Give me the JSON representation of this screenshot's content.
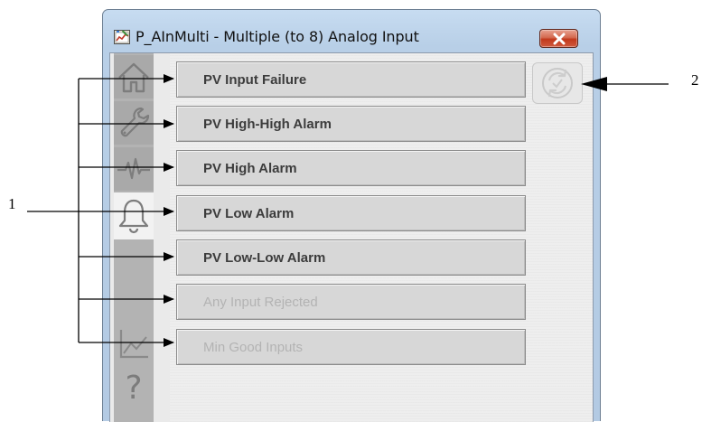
{
  "window": {
    "title": "P_AInMulti - Multiple (to 8) Analog Input",
    "app_icon": "faceplate-app-icon",
    "close_icon": "close-x-icon"
  },
  "sidebar": {
    "tabs": [
      {
        "name": "home-tab",
        "icon": "home-icon",
        "state": "inactive"
      },
      {
        "name": "maintenance-tab",
        "icon": "wrench-icon",
        "state": "inactive"
      },
      {
        "name": "engineering-tab",
        "icon": "waveform-icon",
        "state": "inactive"
      },
      {
        "name": "alarms-tab",
        "icon": "bell-icon",
        "state": "active"
      },
      {
        "name": "trends-tab",
        "icon": "trend-chart-icon",
        "state": "plain"
      },
      {
        "name": "help-tab",
        "icon": "help-question-icon",
        "state": "plain"
      }
    ],
    "help_glyph": "?"
  },
  "alarms": [
    {
      "label": "PV Input Failure",
      "enabled": true
    },
    {
      "label": "PV High-High Alarm",
      "enabled": true
    },
    {
      "label": "PV High Alarm",
      "enabled": true
    },
    {
      "label": "PV Low Alarm",
      "enabled": true
    },
    {
      "label": "PV Low-Low Alarm",
      "enabled": true
    },
    {
      "label": "Any Input Rejected",
      "enabled": false
    },
    {
      "label": "Min Good Inputs",
      "enabled": false
    }
  ],
  "reset_button": {
    "icon": "reset-acknowledge-icon",
    "enabled": false
  },
  "callouts": {
    "label_1": "1",
    "label_2": "2"
  },
  "colors": {
    "titlebar": "#b8cfe7",
    "close_button": "#c2391c",
    "enabled_text": "#3c3c3c",
    "disabled_text": "#b3b3b3",
    "active_tab": "#f2f2f2",
    "inactive_tab": "#a9a9a9"
  }
}
